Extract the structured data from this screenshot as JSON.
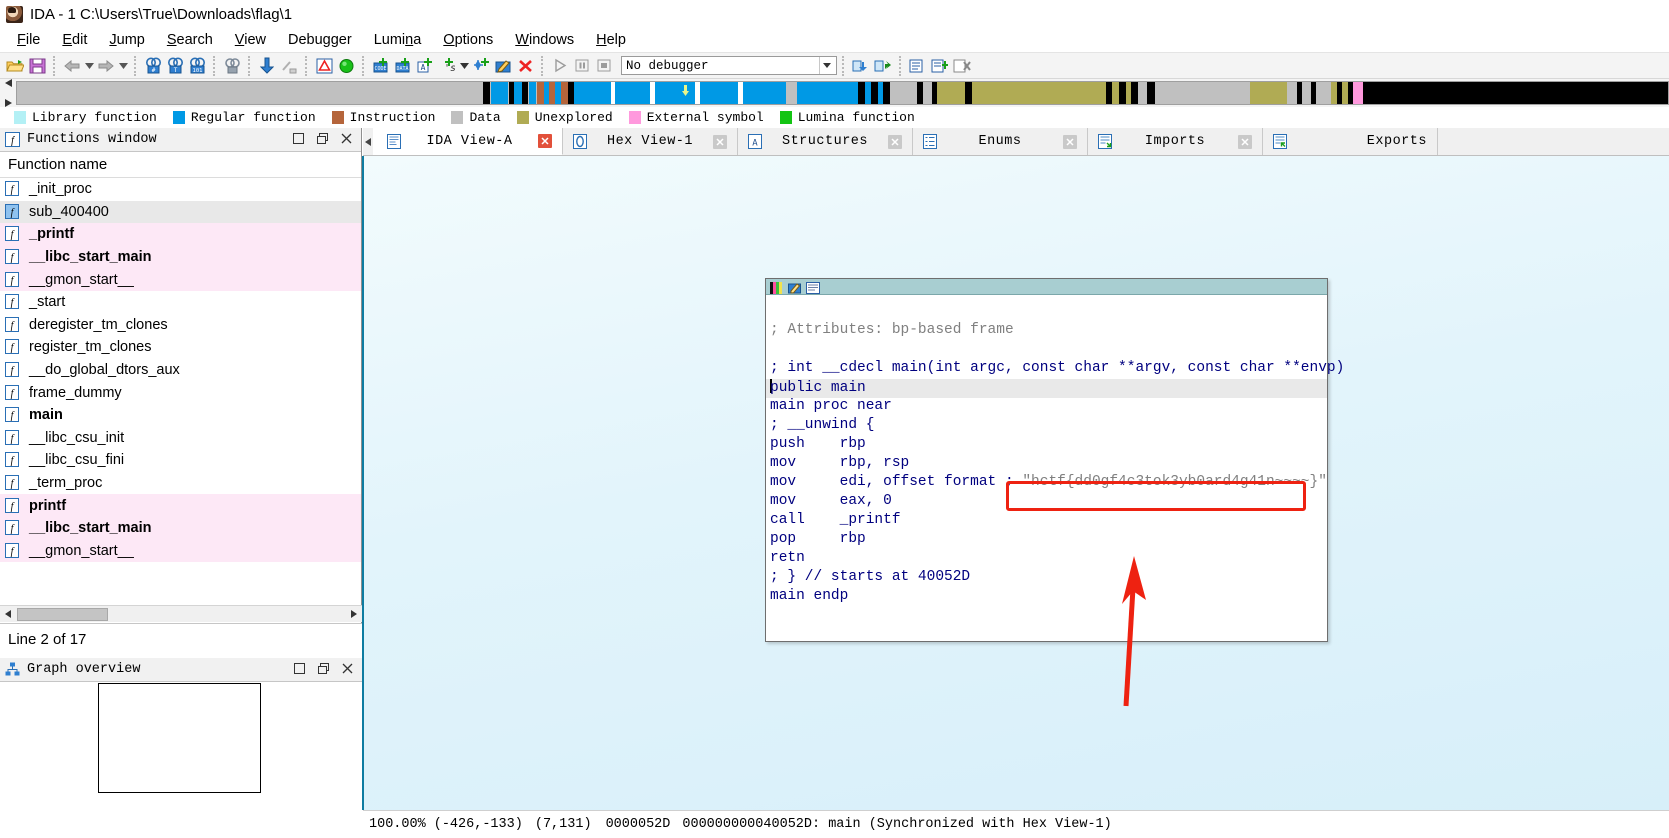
{
  "window": {
    "title": "IDA - 1 C:\\Users\\True\\Downloads\\flag\\1",
    "icon": "ida-logo-icon"
  },
  "menubar": {
    "items": [
      {
        "label": "File",
        "accel": "F"
      },
      {
        "label": "Edit",
        "accel": "E"
      },
      {
        "label": "Jump",
        "accel": "J"
      },
      {
        "label": "Search",
        "accel": "S"
      },
      {
        "label": "View",
        "accel": "V"
      },
      {
        "label": "Debugger",
        "accel": "g"
      },
      {
        "label": "Lumina",
        "accel": "n"
      },
      {
        "label": "Options",
        "accel": "O"
      },
      {
        "label": "Windows",
        "accel": "W"
      },
      {
        "label": "Help",
        "accel": "H"
      }
    ]
  },
  "toolbar": {
    "buttons": [
      "open-file-icon",
      "save-icon",
      "back-arrow-icon",
      "back-dropdown-icon",
      "forward-arrow-icon",
      "forward-dropdown-icon",
      "search-hex-icon",
      "search-text-icon",
      "search-sequence-icon",
      "search-binary-icon",
      "jump-down-icon",
      "no-jump-icon",
      "warning-icon",
      "run-to-icon",
      "make-code-icon",
      "make-data-icon",
      "make-array-icon",
      "make-string-icon",
      "string-dropdown-icon",
      "make-struct-icon",
      "edit-function-icon",
      "undefine-icon",
      "run-icon",
      "pause-icon",
      "stop-icon"
    ],
    "debugger_select": {
      "value": "No debugger",
      "dropdown_icon": "chevron-down-icon"
    },
    "right_buttons": [
      "step-into-icon",
      "step-over-icon",
      "lumina-icon",
      "lumina-push-icon",
      "lumina-del-icon"
    ]
  },
  "navband": {
    "left_arrow_icon": "nav-left-icon",
    "right_arrow_icon": "nav-right-icon",
    "cursor_icon": "nav-cursor-icon",
    "segments": [
      {
        "color": "#c0c0c0",
        "left_pct": 0.0,
        "width_pct": 28.2
      },
      {
        "color": "#000000",
        "left_pct": 28.2,
        "width_pct": 0.45
      },
      {
        "color": "#0099e5",
        "left_pct": 28.7,
        "width_pct": 1.05
      },
      {
        "color": "#000000",
        "left_pct": 29.8,
        "width_pct": 0.3
      },
      {
        "color": "#0099e5",
        "left_pct": 30.1,
        "width_pct": 0.5
      },
      {
        "color": "#000000",
        "left_pct": 30.6,
        "width_pct": 0.35
      },
      {
        "color": "#0099e5",
        "left_pct": 31.0,
        "width_pct": 0.45
      },
      {
        "color": "#b5653b",
        "left_pct": 31.5,
        "width_pct": 0.4
      },
      {
        "color": "#0099e5",
        "left_pct": 31.9,
        "width_pct": 0.3
      },
      {
        "color": "#b5653b",
        "left_pct": 32.2,
        "width_pct": 0.4
      },
      {
        "color": "#0099e5",
        "left_pct": 32.6,
        "width_pct": 0.35
      },
      {
        "color": "#b5653b",
        "left_pct": 32.95,
        "width_pct": 0.4
      },
      {
        "color": "#000000",
        "left_pct": 33.35,
        "width_pct": 0.4
      },
      {
        "color": "#0099e5",
        "left_pct": 33.75,
        "width_pct": 2.2
      },
      {
        "color": "#ffffff",
        "left_pct": 35.95,
        "width_pct": 0.3
      },
      {
        "color": "#0099e5",
        "left_pct": 36.25,
        "width_pct": 2.1
      },
      {
        "color": "#ffffff",
        "left_pct": 38.35,
        "width_pct": 0.3
      },
      {
        "color": "#0099e5",
        "left_pct": 38.65,
        "width_pct": 2.4
      },
      {
        "color": "#ffffff",
        "left_pct": 41.05,
        "width_pct": 0.3
      },
      {
        "color": "#0099e5",
        "left_pct": 41.35,
        "width_pct": 2.3
      },
      {
        "color": "#ffffff",
        "left_pct": 43.65,
        "width_pct": 0.3
      },
      {
        "color": "#0099e5",
        "left_pct": 43.95,
        "width_pct": 2.6
      },
      {
        "color": "#c0c0c0",
        "left_pct": 46.55,
        "width_pct": 0.7
      },
      {
        "color": "#0099e5",
        "left_pct": 47.25,
        "width_pct": 3.7
      },
      {
        "color": "#000000",
        "left_pct": 50.95,
        "width_pct": 0.4
      },
      {
        "color": "#0099e5",
        "left_pct": 51.35,
        "width_pct": 0.35
      },
      {
        "color": "#000000",
        "left_pct": 51.7,
        "width_pct": 0.45
      },
      {
        "color": "#0099e5",
        "left_pct": 52.15,
        "width_pct": 0.3
      },
      {
        "color": "#000000",
        "left_pct": 52.45,
        "width_pct": 0.45
      },
      {
        "color": "#c0c0c0",
        "left_pct": 52.9,
        "width_pct": 1.6
      },
      {
        "color": "#000000",
        "left_pct": 54.5,
        "width_pct": 0.4
      },
      {
        "color": "#c0c0c0",
        "left_pct": 54.9,
        "width_pct": 0.5
      },
      {
        "color": "#000000",
        "left_pct": 55.4,
        "width_pct": 0.35
      },
      {
        "color": "#b0ab54",
        "left_pct": 55.75,
        "width_pct": 1.7
      },
      {
        "color": "#000000",
        "left_pct": 57.45,
        "width_pct": 0.4
      },
      {
        "color": "#b0ab54",
        "left_pct": 57.85,
        "width_pct": 8.1
      },
      {
        "color": "#000000",
        "left_pct": 65.95,
        "width_pct": 0.4
      },
      {
        "color": "#b0ab54",
        "left_pct": 66.35,
        "width_pct": 0.4
      },
      {
        "color": "#000000",
        "left_pct": 66.75,
        "width_pct": 0.4
      },
      {
        "color": "#b0ab54",
        "left_pct": 67.15,
        "width_pct": 0.35
      },
      {
        "color": "#000000",
        "left_pct": 67.5,
        "width_pct": 0.4
      },
      {
        "color": "#c0c0c0",
        "left_pct": 67.9,
        "width_pct": 0.55
      },
      {
        "color": "#000000",
        "left_pct": 68.45,
        "width_pct": 0.45
      },
      {
        "color": "#c0c0c0",
        "left_pct": 68.9,
        "width_pct": 5.8
      },
      {
        "color": "#b0ab54",
        "left_pct": 74.7,
        "width_pct": 2.2
      },
      {
        "color": "#c0c0c0",
        "left_pct": 76.9,
        "width_pct": 0.6
      },
      {
        "color": "#000000",
        "left_pct": 77.5,
        "width_pct": 0.35
      },
      {
        "color": "#c0c0c0",
        "left_pct": 77.85,
        "width_pct": 0.5
      },
      {
        "color": "#000000",
        "left_pct": 78.35,
        "width_pct": 0.35
      },
      {
        "color": "#c0c0c0",
        "left_pct": 78.7,
        "width_pct": 0.9
      },
      {
        "color": "#b0ab54",
        "left_pct": 79.6,
        "width_pct": 0.35
      },
      {
        "color": "#000000",
        "left_pct": 79.95,
        "width_pct": 0.3
      },
      {
        "color": "#b0ab54",
        "left_pct": 80.25,
        "width_pct": 0.35
      },
      {
        "color": "#000000",
        "left_pct": 80.6,
        "width_pct": 0.35
      },
      {
        "color": "#ff99dd",
        "left_pct": 80.95,
        "width_pct": 0.55
      },
      {
        "color": "#000000",
        "left_pct": 81.5,
        "width_pct": 18.5
      }
    ],
    "cursor_pct": 40.3
  },
  "legend": {
    "items": [
      {
        "label": "Library function",
        "color": "#b3f0f5"
      },
      {
        "label": "Regular function",
        "color": "#0099e5"
      },
      {
        "label": "Instruction",
        "color": "#b5653b"
      },
      {
        "label": "Data",
        "color": "#c0c0c0"
      },
      {
        "label": "Unexplored",
        "color": "#b0ab54"
      },
      {
        "label": "External symbol",
        "color": "#ff99dd"
      },
      {
        "label": "Lumina function",
        "color": "#13c413"
      }
    ]
  },
  "tabs": [
    {
      "label": "IDA View-A",
      "icon": "ida-view-icon",
      "active": true,
      "close_icon": "close-icon"
    },
    {
      "label": "Hex View-1",
      "icon": "hex-view-icon",
      "active": false,
      "close_icon": "close-icon"
    },
    {
      "label": "Structures",
      "icon": "structures-icon",
      "active": false,
      "close_icon": "close-icon"
    },
    {
      "label": "Enums",
      "icon": "enums-icon",
      "active": false,
      "close_icon": "close-icon"
    },
    {
      "label": "Imports",
      "icon": "imports-icon",
      "active": false,
      "close_icon": "close-icon"
    },
    {
      "label": "Exports",
      "icon": "exports-icon",
      "active": false,
      "close_icon": ""
    }
  ],
  "functions_panel": {
    "title": "Functions window",
    "title_icon": "function-f-icon",
    "window_buttons": [
      "restore-icon",
      "maximize-icon",
      "close-icon"
    ],
    "column_header": "Function name",
    "status": "Line 2 of 17",
    "rows": [
      {
        "name": "_init_proc",
        "state": "normal",
        "bold": false
      },
      {
        "name": "sub_400400",
        "state": "selected",
        "bold": false
      },
      {
        "name": "_printf",
        "state": "library",
        "bold": true
      },
      {
        "name": "__libc_start_main",
        "state": "library",
        "bold": true
      },
      {
        "name": "__gmon_start__",
        "state": "library",
        "bold": false
      },
      {
        "name": "_start",
        "state": "normal",
        "bold": false
      },
      {
        "name": "deregister_tm_clones",
        "state": "normal",
        "bold": false
      },
      {
        "name": "register_tm_clones",
        "state": "normal",
        "bold": false
      },
      {
        "name": "__do_global_dtors_aux",
        "state": "normal",
        "bold": false
      },
      {
        "name": "frame_dummy",
        "state": "normal",
        "bold": false
      },
      {
        "name": "main",
        "state": "normal",
        "bold": true
      },
      {
        "name": "__libc_csu_init",
        "state": "normal",
        "bold": false
      },
      {
        "name": "__libc_csu_fini",
        "state": "normal",
        "bold": false
      },
      {
        "name": "_term_proc",
        "state": "normal",
        "bold": false
      },
      {
        "name": "printf",
        "state": "library",
        "bold": true
      },
      {
        "name": "__libc_start_main",
        "state": "library",
        "bold": true
      },
      {
        "name": "__gmon_start__",
        "state": "library",
        "bold": false
      }
    ]
  },
  "graph_overview": {
    "title": "Graph overview",
    "title_icon": "graph-overview-icon",
    "window_buttons": [
      "restore-icon",
      "maximize-icon",
      "close-icon"
    ]
  },
  "ida_view": {
    "node_header_icons": [
      "color-palette-icon",
      "edit-node-icon",
      "node-properties-icon"
    ],
    "lines": [
      {
        "text": "; Attributes: bp-based frame",
        "style": "comment",
        "highlight": false,
        "cursor": false
      },
      {
        "text": "",
        "style": "blank",
        "highlight": false,
        "cursor": false
      },
      {
        "text": "; int __cdecl main(int argc, const char **argv, const char **envp)",
        "style": "code",
        "highlight": false,
        "cursor": false
      },
      {
        "text": "public main",
        "style": "code",
        "highlight": true,
        "cursor": true
      },
      {
        "text": "main proc near",
        "style": "code",
        "highlight": false,
        "cursor": false
      },
      {
        "text": "; __unwind {",
        "style": "code",
        "highlight": false,
        "cursor": false
      },
      {
        "text": "push    rbp",
        "style": "code",
        "highlight": false,
        "cursor": false
      },
      {
        "text": "mov     rbp, rsp",
        "style": "code",
        "highlight": false,
        "cursor": false
      },
      {
        "text": "mov     edi, offset format ;",
        "style": "code",
        "highlight": false,
        "cursor": false
      },
      {
        "text": "mov     eax, 0",
        "style": "code",
        "highlight": false,
        "cursor": false
      },
      {
        "text": "call    _printf",
        "style": "code",
        "highlight": false,
        "cursor": false
      },
      {
        "text": "pop     rbp",
        "style": "code",
        "highlight": false,
        "cursor": false
      },
      {
        "text": "retn",
        "style": "code",
        "highlight": false,
        "cursor": false
      },
      {
        "text": "; } // starts at 40052D",
        "style": "code",
        "highlight": false,
        "cursor": false
      },
      {
        "text": "main endp",
        "style": "code",
        "highlight": false,
        "cursor": false
      }
    ],
    "flag_string": "\"hctf{dd0gf4c3tok3yb0ard4g41n~~~~}\"",
    "annotation": {
      "box_color": "#ee2211",
      "arrow_color": "#ee2211",
      "arrow_icon": "annotation-arrow-icon"
    }
  },
  "status_bar": {
    "zoom": "100.00%",
    "offset": "(-426,-133)",
    "graph_coords": "(7,131)",
    "file_offset": "0000052D",
    "address": "000000000040052D: main (Synchronized with Hex View-1)"
  }
}
